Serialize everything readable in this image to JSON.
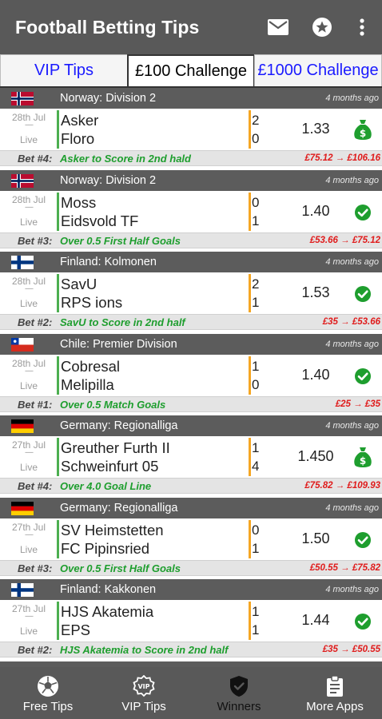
{
  "appbar": {
    "title": "Football Betting Tips",
    "icons": [
      "mail-icon",
      "star-icon",
      "more-vert-icon"
    ]
  },
  "tabs": [
    {
      "label": "VIP Tips",
      "active": false
    },
    {
      "label": "£100 Challenge",
      "active": true
    },
    {
      "label": "£1000 Challenge",
      "active": false
    }
  ],
  "colors": {
    "appbar": "#595959",
    "league_header": "#5c5c5c",
    "tab_link": "#1a1aff",
    "tip_green": "#1e9e2e",
    "money_red": "#e01b1b",
    "win_green": "#1e9e2e",
    "separator_green": "#4caf50",
    "separator_amber": "#f5a623"
  },
  "matches": [
    {
      "flag": "norway",
      "league": "Norway: Division 2",
      "ago": "4 months ago",
      "date": "28th Jul",
      "dash": "-----",
      "status": "Live",
      "home": "Asker",
      "away": "Floro",
      "home_score": "2",
      "away_score": "0",
      "odds": "1.33",
      "result_icon": "money-bag-icon",
      "bet_num": "Bet #4:",
      "tip": "Asker to Score in 2nd hald",
      "money": "£75.12 → £106.16"
    },
    {
      "flag": "norway",
      "league": "Norway: Division 2",
      "ago": "4 months ago",
      "date": "28th Jul",
      "dash": "-----",
      "status": "Live",
      "home": "Moss",
      "away": "Eidsvold TF",
      "home_score": "0",
      "away_score": "1",
      "odds": "1.40",
      "result_icon": "check-circle-icon",
      "bet_num": "Bet #3:",
      "tip": "Over 0.5 First Half Goals",
      "money": "£53.66 → £75.12"
    },
    {
      "flag": "finland",
      "league": "Finland: Kolmonen",
      "ago": "4 months ago",
      "date": "28th Jul",
      "dash": "-----",
      "status": "Live",
      "home": "SavU",
      "away": "RPS ions",
      "home_score": "2",
      "away_score": "1",
      "odds": "1.53",
      "result_icon": "check-circle-icon",
      "bet_num": "Bet #2:",
      "tip": "SavU to Score in 2nd half",
      "money": "£35 → £53.66"
    },
    {
      "flag": "chile",
      "league": "Chile: Premier Division",
      "ago": "4 months ago",
      "date": "28th Jul",
      "dash": "-----",
      "status": "Live",
      "home": "Cobresal",
      "away": "Melipilla",
      "home_score": "1",
      "away_score": "0",
      "odds": "1.40",
      "result_icon": "check-circle-icon",
      "bet_num": "Bet #1:",
      "tip": "Over 0.5 Match Goals",
      "money": "£25 → £35"
    },
    {
      "flag": "germany",
      "league": "Germany: Regionalliga",
      "ago": "4 months ago",
      "date": "27th Jul",
      "dash": "-----",
      "status": "Live",
      "home": "Greuther Furth II",
      "away": "Schweinfurt 05",
      "home_score": "1",
      "away_score": "4",
      "odds": "1.450",
      "result_icon": "money-bag-icon",
      "bet_num": "Bet #4:",
      "tip": "Over 4.0 Goal Line",
      "money": "£75.82 → £109.93"
    },
    {
      "flag": "germany",
      "league": "Germany: Regionalliga",
      "ago": "4 months ago",
      "date": "27th Jul",
      "dash": "-----",
      "status": "Live",
      "home": "SV Heimstetten",
      "away": "FC Pipinsried",
      "home_score": "0",
      "away_score": "1",
      "odds": "1.50",
      "result_icon": "check-circle-icon",
      "bet_num": "Bet #3:",
      "tip": "Over 0.5 First Half Goals",
      "money": "£50.55 → £75.82"
    },
    {
      "flag": "finland",
      "league": "Finland: Kakkonen",
      "ago": "4 months ago",
      "date": "27th Jul",
      "dash": "-----",
      "status": "Live",
      "home": "HJS Akatemia",
      "away": "EPS",
      "home_score": "1",
      "away_score": "1",
      "odds": "1.44",
      "result_icon": "check-circle-icon",
      "bet_num": "Bet #2:",
      "tip": "HJS Akatemia to Score in 2nd half",
      "money": "£35 → £50.55"
    }
  ],
  "bottomnav": [
    {
      "label": "Free Tips",
      "icon": "soccer-ball-icon",
      "active": false
    },
    {
      "label": "VIP Tips",
      "icon": "vip-badge-icon",
      "active": false
    },
    {
      "label": "Winners",
      "icon": "shield-check-icon",
      "active": true
    },
    {
      "label": "More Apps",
      "icon": "clipboard-icon",
      "active": false
    }
  ]
}
